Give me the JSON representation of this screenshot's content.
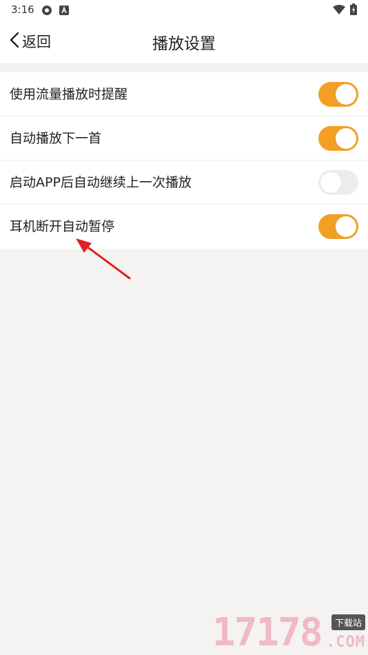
{
  "status_bar": {
    "time": "3:16"
  },
  "header": {
    "back_label": "返回",
    "title": "播放设置"
  },
  "settings": [
    {
      "label": "使用流量播放时提醒",
      "enabled": true
    },
    {
      "label": "自动播放下一首",
      "enabled": true
    },
    {
      "label": "启动APP后自动继续上一次播放",
      "enabled": false
    },
    {
      "label": "耳机断开自动暂停",
      "enabled": true
    }
  ],
  "colors": {
    "accent": "#f29f25",
    "toggle_off": "#ececec",
    "background": "#f4f3f1",
    "arrow": "#e02020"
  },
  "watermark": {
    "number": "17178",
    "badge": "下载站",
    "suffix": ".COM"
  }
}
